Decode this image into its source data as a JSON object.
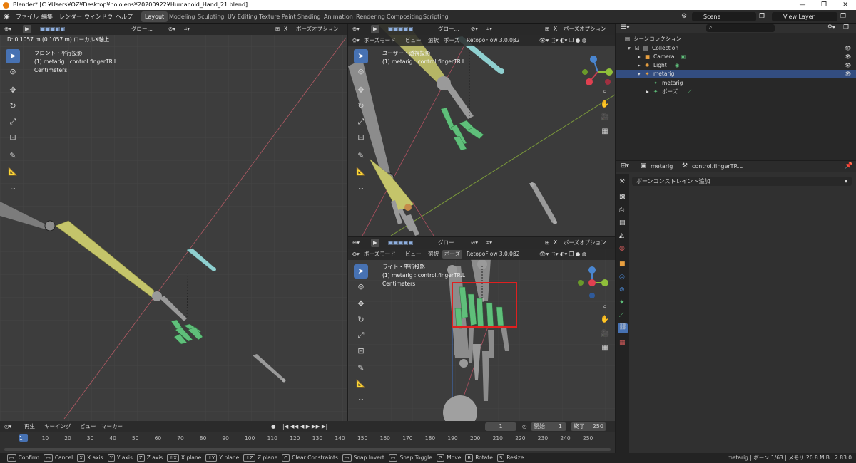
{
  "window": {
    "title": "Blender* [C:¥Users¥OZ¥Desktop¥hololens¥20200922¥Humanoid_Hand_21.blend]"
  },
  "menu": [
    "ファイル",
    "編集",
    "レンダー",
    "ウィンドウ",
    "ヘルプ"
  ],
  "workspaces": [
    {
      "label": "Layout",
      "active": true
    },
    {
      "label": "Modeling"
    },
    {
      "label": "Sculpting"
    },
    {
      "label": "UV Editing"
    },
    {
      "label": "Texture Paint"
    },
    {
      "label": "Shading"
    },
    {
      "label": "Animation"
    },
    {
      "label": "Rendering"
    },
    {
      "label": "Compositing"
    },
    {
      "label": "Scripting"
    }
  ],
  "scene": {
    "name": "Scene"
  },
  "view_layer": {
    "name": "View Layer"
  },
  "viewport_left": {
    "status": "D: 0.1057 m (0.1057 m) ローカルX軸上",
    "transform": "グロー…",
    "options": "ボーズオプション",
    "view_name": "フロント・平行投影",
    "object": "(1) metarig : control.fingerTR.L",
    "units": "Centimeters"
  },
  "viewport_tr": {
    "mode": "ボーズモード",
    "menus": [
      "ビュー",
      "選択",
      "ポーズ"
    ],
    "addon": "RetopoFlow 3.0.0β2",
    "transform": "グロー…",
    "options": "ボーズオプション",
    "view_name": "ユーザー・透視投影",
    "object": "(1) metarig : control.fingerTR.L"
  },
  "viewport_br": {
    "mode": "ボーズモード",
    "menus": [
      "ビュー",
      "選択",
      "ポーズ"
    ],
    "addon": "RetopoFlow 3.0.0β2",
    "transform": "グロー…",
    "options": "ボーズオプション",
    "view_name": "ライト・平行投影",
    "object": "(1) metarig : control.fingerTR.L",
    "units": "Centimeters"
  },
  "outliner": {
    "rows": [
      {
        "label": "シーンコレクション"
      },
      {
        "label": "Collection"
      },
      {
        "label": "Camera"
      },
      {
        "label": "Light"
      },
      {
        "label": "metarig",
        "selected": true
      },
      {
        "label": "metarig"
      },
      {
        "label": "ポーズ"
      }
    ]
  },
  "properties": {
    "object": "metarig",
    "bone": "control.fingerTR.L",
    "add_constraint": "ボーンコンストレイント追加"
  },
  "timeline": {
    "menus": [
      "再生",
      "キーイング",
      "ビュー",
      "マーカー"
    ],
    "current_frame": "1",
    "start_label": "開始",
    "start": "1",
    "end_label": "終了",
    "end": "250",
    "ticks": [
      "1",
      "10",
      "20",
      "30",
      "40",
      "50",
      "60",
      "70",
      "80",
      "90",
      "100",
      "110",
      "120",
      "130",
      "140",
      "150",
      "160",
      "170",
      "180",
      "190",
      "200",
      "210",
      "220",
      "230",
      "240",
      "250"
    ]
  },
  "statusbar": {
    "items": [
      {
        "key": "",
        "label": "Confirm"
      },
      {
        "key": "",
        "label": "Cancel"
      },
      {
        "key": "X",
        "label": "X axis"
      },
      {
        "key": "Y",
        "label": "Y axis"
      },
      {
        "key": "Z",
        "label": "Z axis"
      },
      {
        "key": "⇧X",
        "label": "X plane"
      },
      {
        "key": "⇧Y",
        "label": "Y plane"
      },
      {
        "key": "⇧Z",
        "label": "Z plane"
      },
      {
        "key": "C",
        "label": "Clear Constraints"
      },
      {
        "key": "",
        "label": "Snap Invert"
      },
      {
        "key": "",
        "label": "Snap Toggle"
      },
      {
        "key": "G",
        "label": "Move"
      },
      {
        "key": "R",
        "label": "Rotate"
      },
      {
        "key": "S",
        "label": "Resize"
      }
    ],
    "right": "metarig | ボーン:1/63 | メモリ:20.8 MiB | 2.83.0"
  },
  "colors": {
    "accent": "#4772b3",
    "highlight_box": "#e02020",
    "bone_yellow": "#c8c878",
    "bone_green": "#5fbf7a",
    "bone_cyan": "#8fd0d0"
  }
}
